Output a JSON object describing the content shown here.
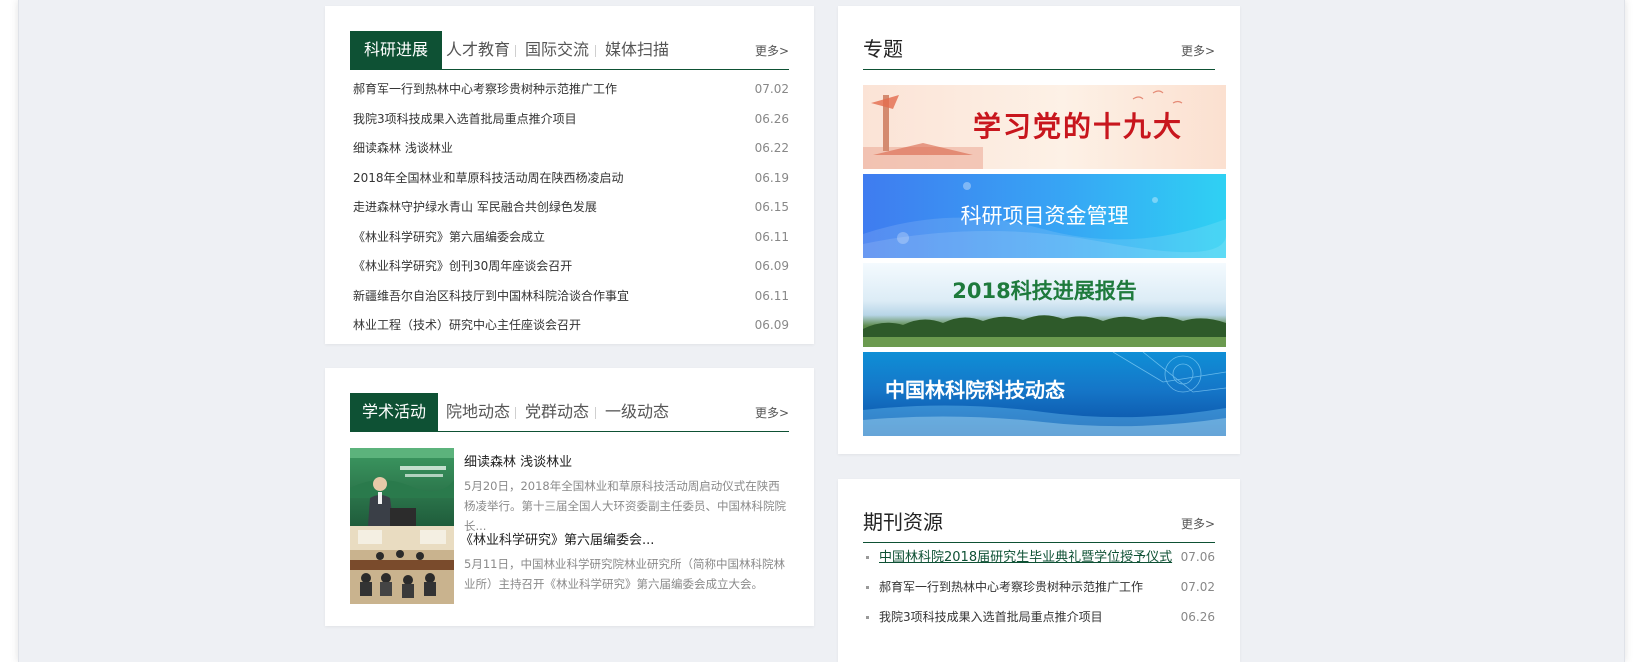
{
  "research": {
    "tabs": [
      "科研进展",
      "人才教育",
      "国际交流",
      "媒体扫描"
    ],
    "more": "更多>",
    "items": [
      {
        "title": "郝育军一行到热林中心考察珍贵树种示范推广工作",
        "date": "07.02"
      },
      {
        "title": "我院3项科技成果入选首批局重点推介项目",
        "date": "06.26"
      },
      {
        "title": "细读森林 浅谈林业",
        "date": "06.22"
      },
      {
        "title": "2018年全国林业和草原科技活动周在陕西杨凌启动",
        "date": "06.19"
      },
      {
        "title": "走进森林守护绿水青山 军民融合共创绿色发展",
        "date": "06.15"
      },
      {
        "title": "《林业科学研究》第六届编委会成立",
        "date": "06.11"
      },
      {
        "title": "《林业科学研究》创刊30周年座谈会召开",
        "date": "06.09"
      },
      {
        "title": "新疆维吾尔自治区科技厅到中国林科院洽谈合作事宜",
        "date": "06.11"
      },
      {
        "title": "林业工程（技术）研究中心主任座谈会召开",
        "date": "06.09"
      }
    ]
  },
  "academic": {
    "tabs": [
      "学术活动",
      "院地动态",
      "党群动态",
      "一级动态"
    ],
    "more": "更多>",
    "news": [
      {
        "title": "细读森林 浅谈林业",
        "desc": "5月20日，2018年全国林业和草原科技活动周启动仪式在陕西杨凌举行。第十三届全国人大环资委副主任委员、中国林科院院长..."
      },
      {
        "title": "《林业科学研究》第六届编委会...",
        "desc": "5月11日，中国林业科学研究院林业研究所（简称中国林科院林业所）主持召开《林业科学研究》第六届编委会成立大会。"
      }
    ]
  },
  "topics": {
    "title": "专题",
    "more": "更多>",
    "banners": [
      "学习党的十九大",
      "科研项目资金管理",
      "2018科技进展报告",
      "中国林科院科技动态"
    ]
  },
  "journals": {
    "title": "期刊资源",
    "more": "更多>",
    "items": [
      {
        "title": "中国林科院2018届研究生毕业典礼暨学位授予仪式",
        "date": "07.06"
      },
      {
        "title": "郝育军一行到热林中心考察珍贵树种示范推广工作",
        "date": "07.02"
      },
      {
        "title": "我院3项科技成果入选首批局重点推介项目",
        "date": "06.26"
      }
    ]
  },
  "colors": {
    "brand": "#0e5134",
    "page_bg": "#eef0f4"
  }
}
